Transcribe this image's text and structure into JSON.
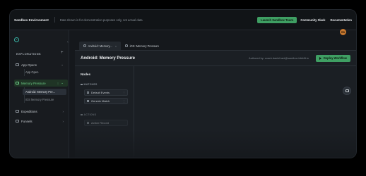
{
  "header": {
    "brand": "Sandbox Environment",
    "notice": "Data shown is for demonstration purposes only, not actual data",
    "launch_button": "Launch Sandbox Tours",
    "community": "Community Slack",
    "docs": "Documentation"
  },
  "user": {
    "initials": "RB"
  },
  "sidebar": {
    "section_label": "EXPLORATIONS",
    "items": [
      {
        "label": "App Opens",
        "children": [
          "App Open"
        ]
      },
      {
        "label": "Memory Pressure",
        "children": [
          "Android: Memory Pre...",
          "iOS Memory Pressure"
        ]
      },
      {
        "label": "Expeditions"
      },
      {
        "label": "Funnels"
      }
    ],
    "more_glyph": "⋮"
  },
  "tabs": [
    {
      "label": "Android: Memory...",
      "active": true
    },
    {
      "label": "iOS: Memory Pressure",
      "active": false
    }
  ],
  "panel": {
    "title": "Android: Memory Pressure",
    "authored": "Authored by: coach.daniel.tani@sandbox.bitdrift.io",
    "deploy_label": "Deploy Workflow"
  },
  "nodes": {
    "title": "Nodes",
    "matches_label": "MATCHES",
    "matches": [
      "Default Events",
      "Generic Match"
    ],
    "actions_label": "ACTIONS",
    "actions": [
      "Action Record"
    ]
  },
  "colors": {
    "accent": "#3f9f63",
    "active_nav": "#6fd08a",
    "background": "#15181c"
  }
}
